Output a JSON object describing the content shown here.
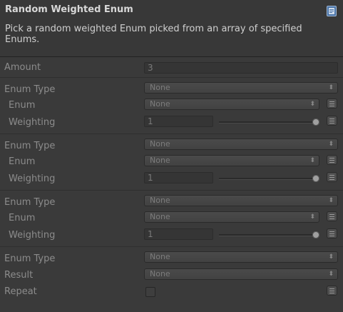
{
  "header": {
    "title": "Random Weighted Enum",
    "description": "Pick a random weighted Enum picked from an array of specified Enums.",
    "help_icon": "help-book-icon"
  },
  "amount": {
    "label": "Amount",
    "value": "3"
  },
  "groups": [
    {
      "enum_type_label": "Enum Type",
      "enum_type_value": "None",
      "enum_label": "Enum",
      "enum_value": "None",
      "weighting_label": "Weighting",
      "weighting_value": "1",
      "weighting_slider": 1.0
    },
    {
      "enum_type_label": "Enum Type",
      "enum_type_value": "None",
      "enum_label": "Enum",
      "enum_value": "None",
      "weighting_label": "Weighting",
      "weighting_value": "1",
      "weighting_slider": 1.0
    },
    {
      "enum_type_label": "Enum Type",
      "enum_type_value": "None",
      "enum_label": "Enum",
      "enum_value": "None",
      "weighting_label": "Weighting",
      "weighting_value": "1",
      "weighting_slider": 1.0
    }
  ],
  "result_section": {
    "enum_type_label": "Enum Type",
    "enum_type_value": "None",
    "result_label": "Result",
    "result_value": "None",
    "repeat_label": "Repeat",
    "repeat_checked": false
  },
  "arrows_glyph": "⬍",
  "colors": {
    "background": "#3a3a3a",
    "header_title": "#d8d8d8",
    "label": "#8c8c8c",
    "help_icon": "#4a74a8"
  }
}
